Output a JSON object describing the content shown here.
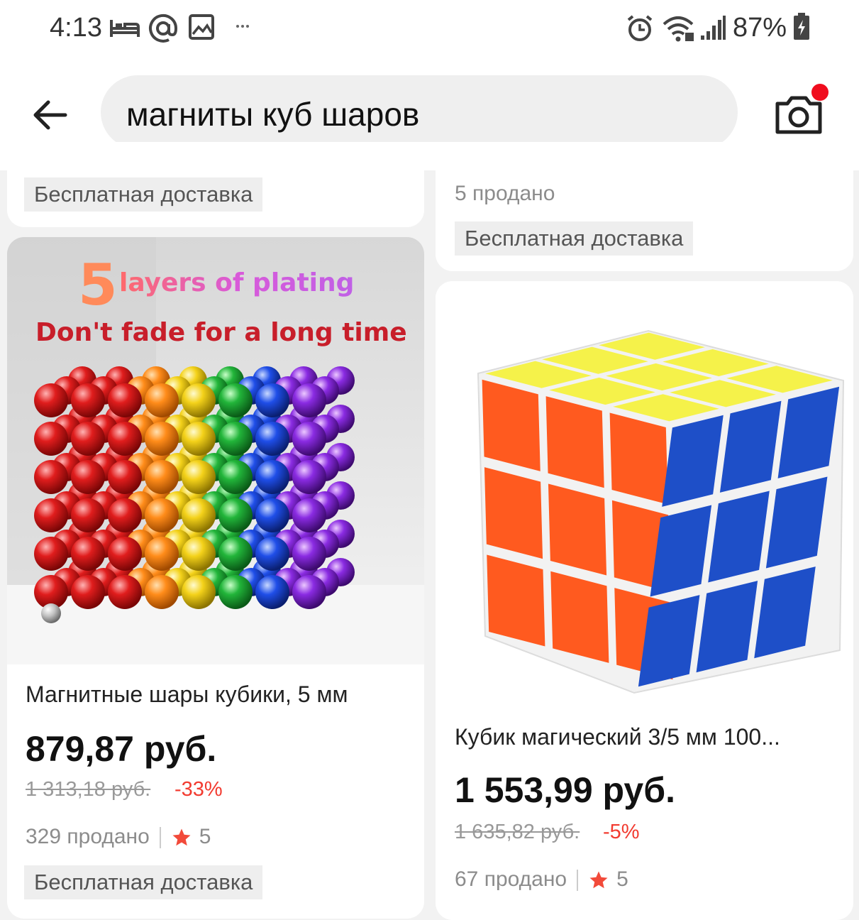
{
  "status_bar": {
    "time": "4:13",
    "battery": "87%",
    "icons": [
      "bed-icon",
      "at-icon",
      "image-icon",
      "more-icon",
      "alarm-icon",
      "wifi-icon",
      "signal-icon",
      "battery-icon"
    ]
  },
  "header": {
    "search_query": "магниты куб шаров",
    "back_icon": "arrow-left-icon",
    "camera_icon": "camera-icon",
    "accent": "#f00d1e"
  },
  "products": [
    {
      "tag": "Бесплатная доставка"
    },
    {
      "sold": "5 продано",
      "tag": "Бесплатная доставка"
    },
    {
      "image_text_line1_num": "5",
      "image_text_line1": "layers of plating",
      "image_text_line2": "Don't fade for a long time",
      "title": "Магнитные шары кубики, 5 мм",
      "price": "879,87 руб.",
      "old_price": "1 313,18 руб.",
      "discount": "-33%",
      "sold": "329 продано",
      "rating": "5",
      "tag": "Бесплатная доставка"
    },
    {
      "title": "Кубик магический 3/5 мм 100...",
      "price": "1 553,99 руб.",
      "old_price": "1 635,82 руб.",
      "discount": "-5%",
      "sold": "67 продано",
      "rating": "5"
    }
  ],
  "colors": {
    "discount": "#f23b30",
    "star": "#f24a3a",
    "free_tag_bg": "#eeeeee"
  }
}
